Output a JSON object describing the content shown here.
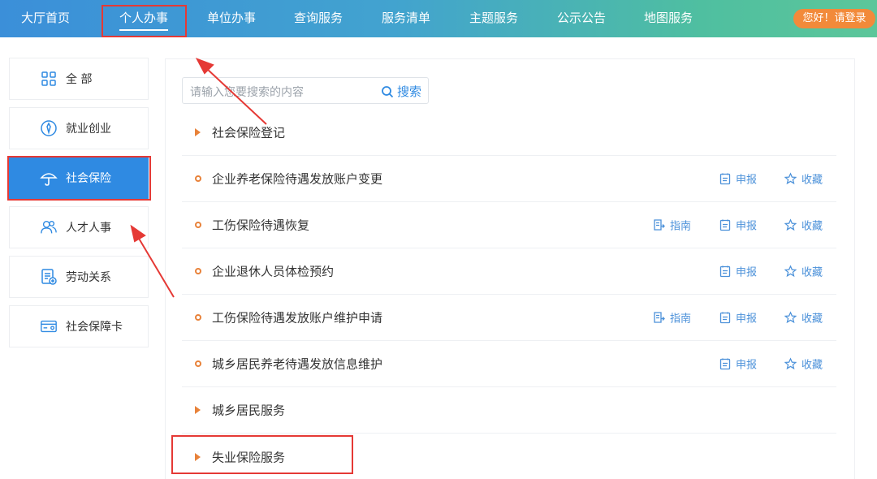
{
  "nav": {
    "items": [
      {
        "label": "大厅首页"
      },
      {
        "label": "个人办事"
      },
      {
        "label": "单位办事"
      },
      {
        "label": "查询服务"
      },
      {
        "label": "服务清单"
      },
      {
        "label": "主题服务"
      },
      {
        "label": "公示公告"
      },
      {
        "label": "地图服务"
      }
    ],
    "active": "个人办事",
    "login_label": "您好！请登录"
  },
  "sidebar": {
    "items": [
      {
        "label": "全 部",
        "icon": "grid-icon"
      },
      {
        "label": "就业创业",
        "icon": "employment-icon"
      },
      {
        "label": "社会保险",
        "icon": "umbrella-icon",
        "active": true
      },
      {
        "label": "人才人事",
        "icon": "people-icon"
      },
      {
        "label": "劳动关系",
        "icon": "document-plus-icon"
      },
      {
        "label": "社会保障卡",
        "icon": "card-icon"
      }
    ]
  },
  "search": {
    "placeholder": "请输入您要搜索的内容",
    "button_label": "搜索"
  },
  "list": {
    "rows": [
      {
        "type": "category",
        "label": "社会保险登记"
      },
      {
        "type": "service",
        "label": "企业养老保险待遇发放账户变更",
        "report": "申报",
        "favorite": "收藏"
      },
      {
        "type": "service",
        "label": "工伤保险待遇恢复",
        "guide": "指南",
        "report": "申报",
        "favorite": "收藏"
      },
      {
        "type": "service",
        "label": "企业退休人员体检预约",
        "report": "申报",
        "favorite": "收藏"
      },
      {
        "type": "service",
        "label": "工伤保险待遇发放账户维护申请",
        "guide": "指南",
        "report": "申报",
        "favorite": "收藏"
      },
      {
        "type": "service",
        "label": "城乡居民养老待遇发放信息维护",
        "report": "申报",
        "favorite": "收藏"
      },
      {
        "type": "category",
        "label": "城乡居民服务"
      },
      {
        "type": "category",
        "label": "失业保险服务"
      }
    ]
  },
  "colors": {
    "nav_gradient_start": "#3b8fd9",
    "nav_gradient_end": "#5cc69a",
    "active_blue": "#2f8ae2",
    "login_orange": "#f28a3a",
    "marker_orange": "#e8823a",
    "annotation_red": "#e53935"
  }
}
